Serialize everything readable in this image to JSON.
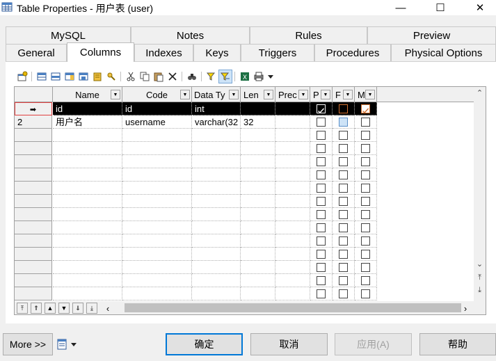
{
  "window": {
    "title": "Table Properties - 用户表 (user)",
    "minimize": "—",
    "maximize": "☐",
    "close": "✕"
  },
  "tabs": {
    "row1": [
      "MySQL",
      "Notes",
      "Rules",
      "Preview"
    ],
    "row2": [
      "General",
      "Columns",
      "Indexes",
      "Keys",
      "Triggers",
      "Procedures",
      "Physical Options"
    ],
    "active": "Columns"
  },
  "toolbar": {
    "icons": [
      "properties-icon",
      "add-row-icon",
      "insert-row-icon",
      "add-column-icon",
      "add-index-icon",
      "add-key-icon",
      "key-search-icon",
      "cut-icon",
      "copy-icon",
      "paste-icon",
      "delete-icon",
      "find-icon",
      "filter-icon",
      "customize-columns-icon",
      "excel-export-icon",
      "print-icon",
      "dropdown-arrow-icon"
    ]
  },
  "columns": {
    "headers": [
      "Name",
      "Code",
      "Data Ty",
      "Len",
      "Prec",
      "P",
      "F",
      "M"
    ]
  },
  "rows": [
    {
      "num": "",
      "name": "id",
      "code": "id",
      "type": "int",
      "len": "",
      "prec": "",
      "p": true,
      "f": false,
      "m": true,
      "selected": true
    },
    {
      "num": "2",
      "name": "用户名",
      "code": "username",
      "type": "varchar(32",
      "len": "32",
      "prec": "",
      "p": false,
      "f": false,
      "m": false,
      "selected": false
    }
  ],
  "buttons": {
    "more": "More >>",
    "ok": "确定",
    "cancel": "取消",
    "apply": "应用(A)",
    "help": "帮助"
  }
}
